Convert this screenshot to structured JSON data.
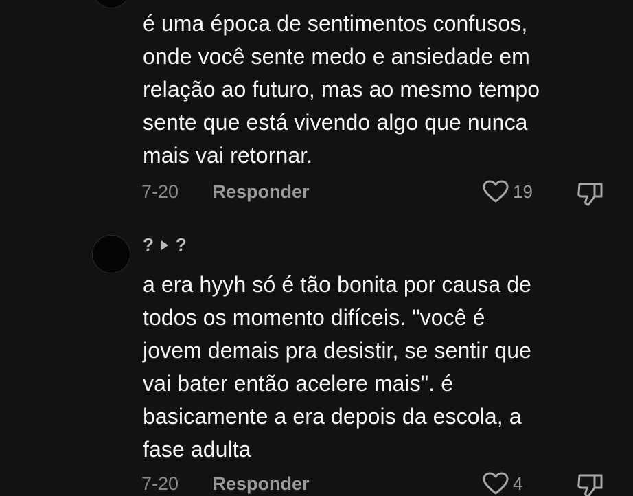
{
  "comments": [
    {
      "text": "é uma época de sentimentos confusos,\nonde você sente medo e ansiedade em\nrelação ao futuro, mas ao mesmo tempo\nsente que está vivendo algo que nunca\nmais vai retornar.",
      "date": "7-20",
      "reply_label": "Responder",
      "likes": "19"
    },
    {
      "username_left": "?",
      "username_right": "?",
      "text": "a era hyyh só é tão bonita por causa de\ntodos os momento difíceis. \"você é\njovem demais pra desistir, se sentir que\nvai bater então acelere mais\". é\nbasicamente a era depois da escola, a\nfase adulta",
      "date": "7-20",
      "reply_label": "Responder",
      "likes": "4"
    }
  ],
  "icons": {
    "like": "heart-outline-icon",
    "dislike": "thumbs-down-icon",
    "separator": "play-triangle-icon"
  },
  "colors": {
    "background": "#121212",
    "text": "#f4f4f4",
    "meta": "#8a8a8a"
  }
}
